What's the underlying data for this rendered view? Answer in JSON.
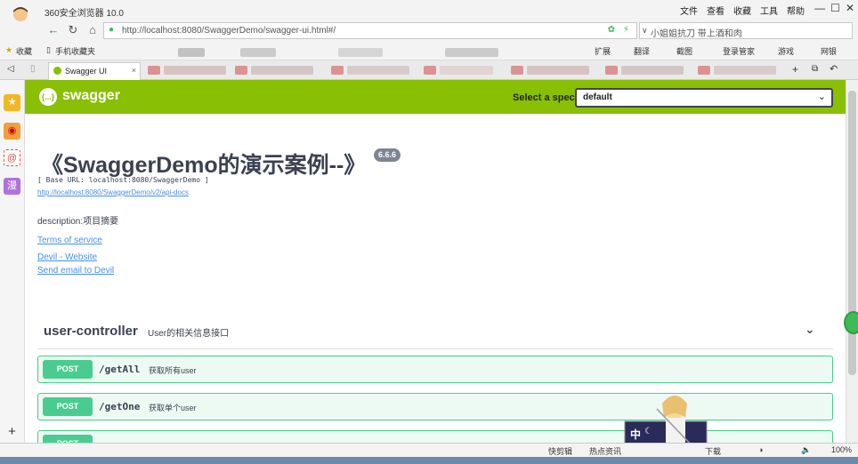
{
  "browser": {
    "title": "360安全浏览器 10.0",
    "menu": [
      "文件",
      "查看",
      "收藏",
      "工具",
      "帮助"
    ],
    "url": "http://localhost:8080/SwaggerDemo/swagger-ui.html#/",
    "search_placeholder": "小姐姐抗刀 带上酒和肉",
    "bookmarks": [
      "收藏",
      "手机收藏夹"
    ],
    "toolbar": [
      "扩展",
      "翻译",
      "截图",
      "登录管家",
      "游戏",
      "网银"
    ],
    "active_tab": "Swagger UI"
  },
  "swagger": {
    "logo": "swagger",
    "logo_glyph": "{...}",
    "spec_label": "Select a spec",
    "spec_value": "default",
    "title": "《SwaggerDemo的演示案例--》",
    "version": "6.6.6",
    "base_url": "[ Base URL: localhost:8080/SwaggerDemo ]",
    "docs_link": "http://localhost:8080/SwaggerDemo/v2/api-docs",
    "description": "description:项目摘要",
    "terms": "Terms of service",
    "website": "Devil - Website",
    "email": "Send email to Devil",
    "tag": {
      "name": "user-controller",
      "description": "User的相关信息接口"
    },
    "operations": [
      {
        "method": "POST",
        "path": "/getAll",
        "summary": "获取所有user"
      },
      {
        "method": "POST",
        "path": "/getOne",
        "summary": "获取单个user"
      },
      {
        "method": "POST",
        "path": "",
        "summary": ""
      }
    ]
  },
  "statusbar": {
    "items": [
      "快剪辑",
      "热点资讯",
      "下载",
      "100%"
    ]
  },
  "widget_label": "中"
}
